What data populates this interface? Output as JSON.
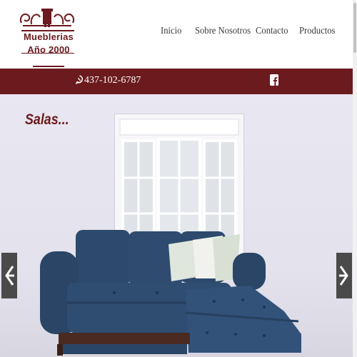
{
  "brand": {
    "line1": "Mueblerias",
    "line2": "Año 2000"
  },
  "nav": {
    "items": [
      "Inicio",
      "Sobre Nosotros",
      "Contacto",
      "Productos"
    ]
  },
  "topbar": {
    "phone": "437-102-6787",
    "social": "facebook-icon"
  },
  "hero": {
    "title": "Salas...",
    "prev_icon": "chevron-left-icon",
    "next_icon": "chevron-right-icon"
  },
  "colors": {
    "brand": "#6b1a1e",
    "sofa": "#2e4a6e",
    "wall": "#e6e4ee"
  }
}
